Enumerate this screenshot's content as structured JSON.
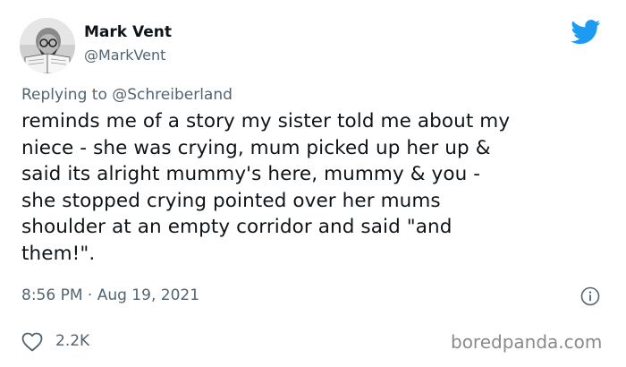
{
  "author": {
    "display_name": "Mark Vent",
    "handle": "@MarkVent"
  },
  "reply": {
    "prefix": "Replying to ",
    "mention": "@Schreiberland"
  },
  "tweet": {
    "lines": [
      "reminds me of a story my sister told me about my",
      "niece - she was crying, mum picked up her up &",
      "said its alright mummy's here, mummy & you -",
      "she stopped crying pointed over her mums",
      "shoulder at an empty corridor and said \"and",
      "them!\"."
    ],
    "timestamp": "8:56 PM · Aug 19, 2021"
  },
  "engagement": {
    "likes": "2.2K"
  },
  "watermark": "boredpanda.com",
  "icons": {
    "brand": "twitter-bird-icon",
    "info": "info-icon",
    "like": "heart-icon"
  },
  "colors": {
    "twitter_blue": "#1d9bf0",
    "secondary_text": "#536471",
    "primary_text": "#0f1419"
  }
}
